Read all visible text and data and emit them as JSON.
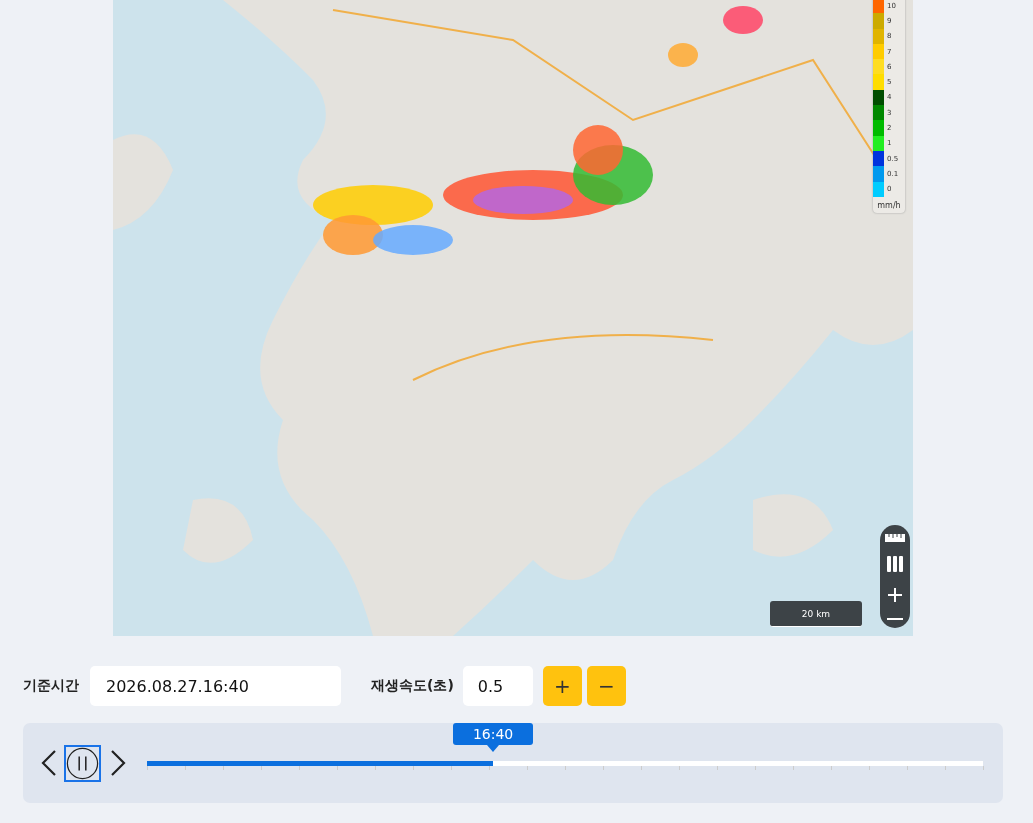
{
  "map": {
    "legend": {
      "unit": "mm/h",
      "items": [
        {
          "label": "10",
          "color": "#ff6600"
        },
        {
          "label": "9",
          "color": "#ccaa00"
        },
        {
          "label": "8",
          "color": "#e0b400"
        },
        {
          "label": "7",
          "color": "#ffcc00"
        },
        {
          "label": "6",
          "color": "#ffdd22"
        },
        {
          "label": "5",
          "color": "#ffdd00"
        },
        {
          "label": "4",
          "color": "#004d00"
        },
        {
          "label": "3",
          "color": "#008800"
        },
        {
          "label": "2",
          "color": "#00bb00"
        },
        {
          "label": "1",
          "color": "#22ee22"
        },
        {
          "label": "0.5",
          "color": "#0033dd"
        },
        {
          "label": "0.1",
          "color": "#0099ee"
        },
        {
          "label": "0",
          "color": "#00ccff"
        }
      ]
    },
    "scale": "20 km"
  },
  "controls": {
    "base_time_label": "기준시간",
    "base_time": "2026.08.27.16:40",
    "speed_label": "재생속도(초)",
    "speed": "0.5",
    "plus": "+",
    "minus": "−"
  },
  "timeline": {
    "current": "16:40",
    "level": 0.414
  }
}
